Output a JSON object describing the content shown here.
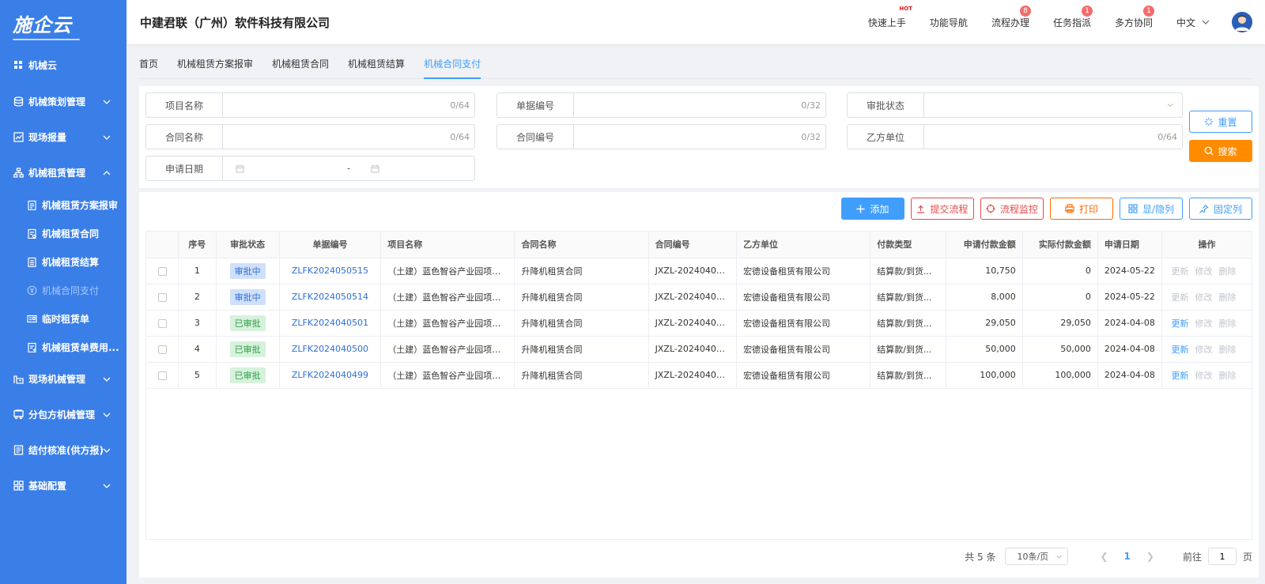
{
  "logo": "施企云",
  "sidebar": {
    "top": "机械云",
    "items": [
      {
        "label": "机械策划管理",
        "icon": "db-icon"
      },
      {
        "label": "现场报量",
        "icon": "chart-icon"
      },
      {
        "label": "机械租赁管理",
        "icon": "network-icon"
      },
      {
        "label": "现场机械管理",
        "icon": "machine-icon"
      },
      {
        "label": "分包方机械管理",
        "icon": "truck-icon"
      },
      {
        "label": "结付核准(供方报)",
        "icon": "doc-icon"
      },
      {
        "label": "基础配置",
        "icon": "grid-icon"
      }
    ],
    "sub": [
      {
        "label": "机械租赁方案报审"
      },
      {
        "label": "机械租赁合同"
      },
      {
        "label": "机械租赁结算"
      },
      {
        "label": "机械合同支付"
      },
      {
        "label": "临时租赁单"
      },
      {
        "label": "机械租赁单费用..."
      }
    ]
  },
  "header": {
    "company": "中建君联（广州）软件科技有限公司",
    "nav": [
      {
        "label": "快速上手",
        "hot": "HOT"
      },
      {
        "label": "功能导航"
      },
      {
        "label": "流程办理",
        "badge": "8"
      },
      {
        "label": "任务指派",
        "badge": "1"
      },
      {
        "label": "多方协同",
        "badge": "1"
      }
    ],
    "lang": "中文"
  },
  "tabs": [
    "首页",
    "机械租赁方案报审",
    "机械租赁合同",
    "机械租赁结算",
    "机械合同支付"
  ],
  "filter": {
    "project_name": {
      "label": "项目名称",
      "count": "0/64"
    },
    "doc_no": {
      "label": "单据编号",
      "count": "0/32"
    },
    "status": {
      "label": "审批状态"
    },
    "contract_name": {
      "label": "合同名称",
      "count": "0/64"
    },
    "contract_no": {
      "label": "合同编号",
      "count": "0/32"
    },
    "party_b": {
      "label": "乙方单位",
      "count": "0/64"
    },
    "apply_date": {
      "label": "申请日期",
      "sep": "-"
    },
    "reset": "重置",
    "search": "搜索"
  },
  "toolbar": {
    "add": "添加",
    "submit": "提交流程",
    "monitor": "流程监控",
    "print": "打印",
    "toggle_cols": "显/隐列",
    "fix_cols": "固定列"
  },
  "table": {
    "headers": [
      "序号",
      "审批状态",
      "单据编号",
      "项目名称",
      "合同名称",
      "合同编号",
      "乙方单位",
      "付款类型",
      "申请付款金额",
      "实际付款金额",
      "申请日期",
      "操作"
    ],
    "rows": [
      {
        "no": "1",
        "status": "审批中",
        "doc": "ZLFK2024050515",
        "project": "（土建）蓝色智谷产业园项目...",
        "contract": "升降机租赁合同",
        "contract_no": "JXZL-20240408...",
        "party": "宏德设备租赁有限公司",
        "pay_type": "结算款/到货...",
        "apply_amt": "10,750",
        "actual_amt": "0",
        "date": "2024-05-22"
      },
      {
        "no": "2",
        "status": "审批中",
        "doc": "ZLFK2024050514",
        "project": "（土建）蓝色智谷产业园项目...",
        "contract": "升降机租赁合同",
        "contract_no": "JXZL-20240408...",
        "party": "宏德设备租赁有限公司",
        "pay_type": "结算款/到货...",
        "apply_amt": "8,000",
        "actual_amt": "0",
        "date": "2024-05-22"
      },
      {
        "no": "3",
        "status": "已审批",
        "doc": "ZLFK2024040501",
        "project": "（土建）蓝色智谷产业园项目...",
        "contract": "升降机租赁合同",
        "contract_no": "JXZL-20240408...",
        "party": "宏德设备租赁有限公司",
        "pay_type": "结算款/到货...",
        "apply_amt": "29,050",
        "actual_amt": "29,050",
        "date": "2024-04-08"
      },
      {
        "no": "4",
        "status": "已审批",
        "doc": "ZLFK2024040500",
        "project": "（土建）蓝色智谷产业园项目...",
        "contract": "升降机租赁合同",
        "contract_no": "JXZL-20240408...",
        "party": "宏德设备租赁有限公司",
        "pay_type": "结算款/到货...",
        "apply_amt": "50,000",
        "actual_amt": "50,000",
        "date": "2024-04-08"
      },
      {
        "no": "5",
        "status": "已审批",
        "doc": "ZLFK2024040499",
        "project": "（土建）蓝色智谷产业园项目...",
        "contract": "升降机租赁合同",
        "contract_no": "JXZL-20240408...",
        "party": "宏德设备租赁有限公司",
        "pay_type": "结算款/到货...",
        "apply_amt": "100,000",
        "actual_amt": "100,000",
        "date": "2024-04-08"
      }
    ],
    "ops": [
      "更新",
      "修改",
      "删除"
    ]
  },
  "pager": {
    "total": "共 5 条",
    "size": "10条/页",
    "current": "1",
    "goto": "前往",
    "goto_value": "1",
    "page": "页"
  },
  "colors": {
    "sidebar": "#3a7ee8",
    "primary": "#409eff",
    "search": "#ff8c00"
  }
}
